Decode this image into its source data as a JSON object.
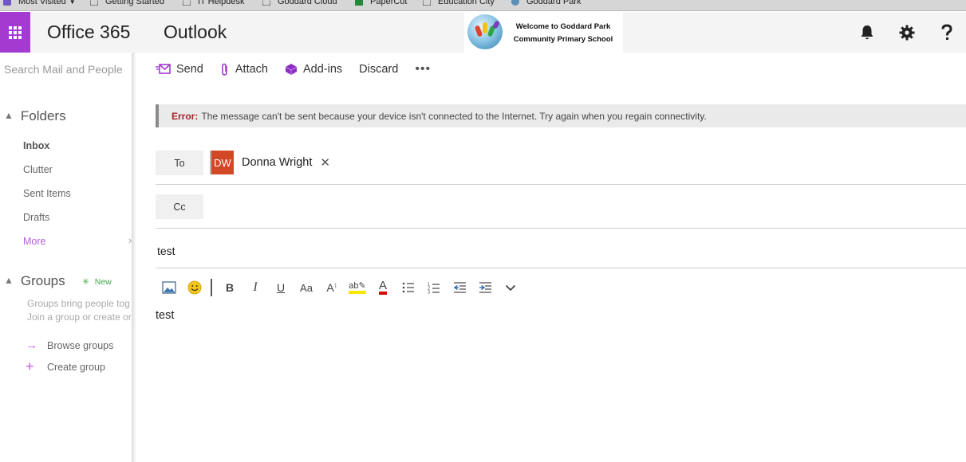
{
  "bookmarks": [
    {
      "label": "Most Visited",
      "icon": "most-visited-icon"
    },
    {
      "label": "Getting Started",
      "icon": "bookmark-icon"
    },
    {
      "label": "IT Helpdesk",
      "icon": "bookmark-icon"
    },
    {
      "label": "Goddard Cloud",
      "icon": "bookmark-icon"
    },
    {
      "label": "PaperCut",
      "icon": "papercut-icon"
    },
    {
      "label": "Education City",
      "icon": "bookmark-icon"
    },
    {
      "label": "Goddard Park",
      "icon": "globe-icon"
    }
  ],
  "header": {
    "brand": "Office 365",
    "app": "Outlook",
    "school_line1": "Welcome to Goddard Park",
    "school_line2": "Community Primary School"
  },
  "nav": {
    "search_placeholder": "Search Mail and People",
    "folders_title": "Folders",
    "folders": [
      {
        "label": "Inbox"
      },
      {
        "label": "Clutter"
      },
      {
        "label": "Sent Items"
      },
      {
        "label": "Drafts"
      },
      {
        "label": "More"
      }
    ],
    "groups_title": "Groups",
    "groups_new": "New",
    "groups_desc_1": "Groups bring people tog",
    "groups_desc_2": "Join a group or create or",
    "browse_groups": "Browse groups",
    "create_group": "Create group"
  },
  "toolbar": {
    "send": "Send",
    "attach": "Attach",
    "addins": "Add-ins",
    "discard": "Discard",
    "more": "•••"
  },
  "error": {
    "label": "Error:",
    "message": "The message can't be sent because your device isn't connected to the Internet. Try again when you regain connectivity."
  },
  "compose": {
    "to_label": "To",
    "cc_label": "Cc",
    "recipient_initials": "DW",
    "recipient_name": "Donna Wright",
    "remove_symbol": "✕",
    "subject": "test",
    "body": "test"
  },
  "format": {
    "font_size_label": "Aa",
    "grow_label": "A",
    "spell_label": "ab",
    "color_label": "A"
  },
  "colors": {
    "accent": "#a33bd0",
    "avatar": "#d24726",
    "error": "#a4262c",
    "new": "#3ca848"
  }
}
